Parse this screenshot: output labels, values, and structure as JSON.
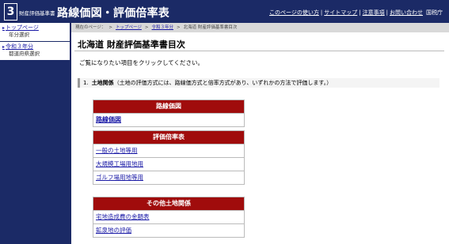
{
  "header": {
    "logo_number": "3",
    "logo_small": "財産評価基準書",
    "logo_big": "路線価図・評価倍率表",
    "links": [
      "このページの使い方",
      "サイトマップ",
      "注意事項",
      "お問い合わせ"
    ],
    "agency": "国税庁"
  },
  "sidebar": {
    "items": [
      {
        "label": "トップページ",
        "sub": "年分選択"
      },
      {
        "label": "令和３年分",
        "sub": "都道府県選択"
      }
    ]
  },
  "breadcrumb": {
    "prefix": "現在のページ：",
    "items": [
      "トップページ",
      "令和３年分"
    ],
    "current": "北海道 財産評価基準書目次"
  },
  "main": {
    "title": "北海道 財産評価基準書目次",
    "intro": "ご覧になりたい項目をクリックしてください。",
    "section": {
      "number": "1.",
      "name": "土地関係",
      "note": "（土地の評価方式には、路線価方式と倍率方式があり、いずれかの方法で評価します。）"
    },
    "blocks": [
      {
        "title": "路線価図",
        "links": [
          "路線価図"
        ]
      },
      {
        "title": "評価倍率表",
        "links": [
          "一般の土地等用",
          "大規模工場用地用",
          "ゴルフ場用地等用"
        ]
      },
      {
        "title": "その他土地関係",
        "links": [
          "宅地造成費の金額表",
          "鉱泉地の評価"
        ]
      }
    ]
  },
  "colors": {
    "header_bg": "#1b2a66",
    "block_title_bg": "#a00c0c",
    "link": "#1a1aa6"
  }
}
